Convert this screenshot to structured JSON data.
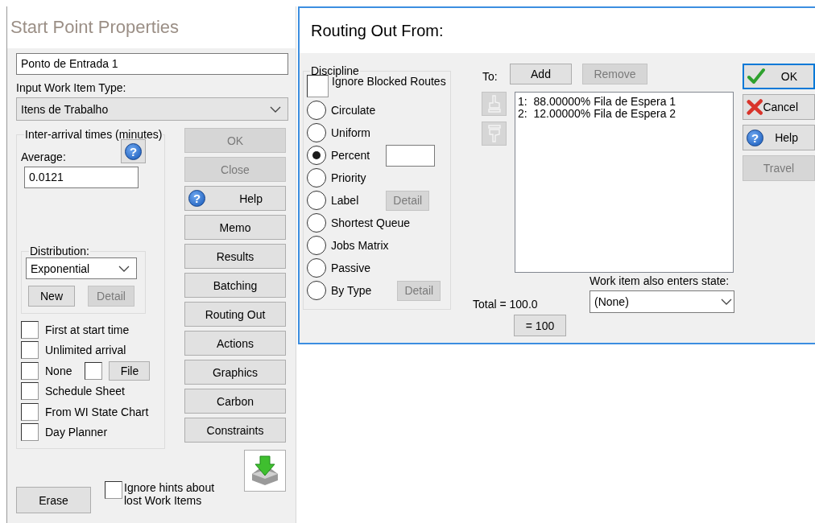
{
  "start_point": {
    "title": "Start Point Properties",
    "name_value": "Ponto de Entrada 1",
    "type_label": "Input Work Item Type:",
    "type_value": "Itens de Trabalho",
    "interarrival": {
      "legend": "Inter-arrival times (minutes)",
      "average_label": "Average:",
      "help_glyph": "?",
      "average_value": "0.0121",
      "distribution": {
        "legend": "Distribution:",
        "value": "Exponential",
        "buttons": [
          {
            "label": "New",
            "disabled": false
          },
          {
            "label": "Detail",
            "disabled": true
          }
        ]
      },
      "options": [
        {
          "label": "First at start time",
          "checked": false
        },
        {
          "label": "Unlimited arrival",
          "checked": false
        },
        {
          "label": "None",
          "checked": false,
          "file": {
            "checked": false,
            "button": "File"
          }
        },
        {
          "label": "Schedule Sheet",
          "checked": false
        },
        {
          "label": "From WI State Chart",
          "checked": false
        },
        {
          "label": "Day Planner",
          "checked": false
        }
      ]
    },
    "buttons": [
      {
        "label": "OK",
        "disabled": true
      },
      {
        "label": "Close",
        "disabled": true
      },
      {
        "label": "Help",
        "disabled": false,
        "kind": "help",
        "glyph": "?"
      },
      {
        "label": "Memo",
        "disabled": false
      },
      {
        "label": "Results",
        "disabled": false
      },
      {
        "label": "Batching",
        "disabled": false
      },
      {
        "label": "Routing Out",
        "disabled": false
      },
      {
        "label": "Actions",
        "disabled": false
      },
      {
        "label": "Graphics",
        "disabled": false
      },
      {
        "label": "Carbon",
        "disabled": false
      },
      {
        "label": "Constraints",
        "disabled": false
      }
    ],
    "erase_button": "Erase",
    "ignore_hints": {
      "label": "Ignore hints about lost Work Items",
      "checked": false
    }
  },
  "routing_out": {
    "title": "Routing Out From:",
    "discipline": {
      "legend": "Discipline",
      "ignore_blocked": {
        "label": "Ignore Blocked Routes",
        "checked": false
      },
      "options": [
        {
          "label": "Circulate",
          "selected": false,
          "kind": "plain"
        },
        {
          "label": "Uniform",
          "selected": false,
          "kind": "plain"
        },
        {
          "label": "Percent",
          "selected": true,
          "kind": "field"
        },
        {
          "label": "Priority",
          "selected": false,
          "kind": "plain"
        },
        {
          "label": "Label",
          "selected": false,
          "kind": "detail",
          "detail": {
            "label": "Detail",
            "disabled": true
          }
        },
        {
          "label": "Shortest Queue",
          "selected": false,
          "kind": "plain"
        },
        {
          "label": "Jobs Matrix",
          "selected": false,
          "kind": "plain"
        },
        {
          "label": "Passive",
          "selected": false,
          "kind": "plain"
        },
        {
          "label": "By Type",
          "selected": false,
          "kind": "detail",
          "detail": {
            "label": "Detail",
            "disabled": true
          }
        }
      ]
    },
    "to_label": "To:",
    "add": {
      "label": "Add",
      "disabled": false
    },
    "remove": {
      "label": "Remove",
      "disabled": true
    },
    "move_buttons": [
      {
        "kind": "up",
        "disabled": true
      },
      {
        "kind": "down",
        "disabled": true
      }
    ],
    "routes": [
      "1:  88.00000% Fila de Espera 1",
      "2:  12.00000% Fila de Espera 2"
    ],
    "total": "Total = 100.0",
    "equalize_button": "= 100",
    "state_label": "Work item also enters state:",
    "state_value": "(None)",
    "side_buttons": [
      {
        "label": "OK",
        "kind": "check",
        "disabled": false,
        "default": true
      },
      {
        "label": "Cancel",
        "kind": "cross",
        "disabled": false,
        "default": false
      },
      {
        "label": "Help",
        "kind": "help",
        "glyph": "?",
        "disabled": false,
        "default": false
      },
      {
        "label": "Travel",
        "kind": "plain",
        "disabled": true,
        "default": false
      }
    ]
  }
}
